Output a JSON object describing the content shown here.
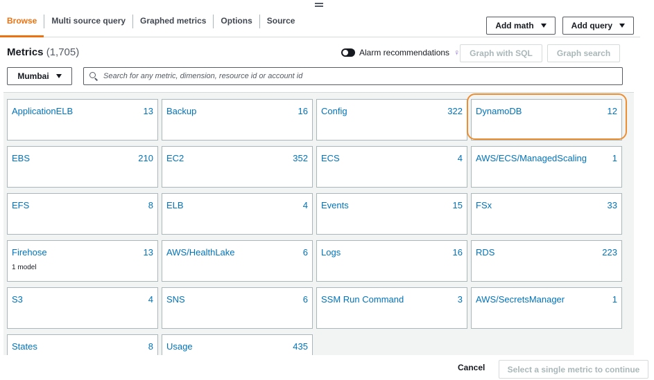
{
  "tabs": [
    {
      "label": "Browse",
      "active": true
    },
    {
      "label": "Multi source query",
      "active": false
    },
    {
      "label": "Graphed metrics",
      "active": false
    },
    {
      "label": "Options",
      "active": false
    },
    {
      "label": "Source",
      "active": false
    }
  ],
  "toolbar": {
    "add_math": "Add math",
    "add_query": "Add query"
  },
  "metrics": {
    "title": "Metrics",
    "count": "(1,705)"
  },
  "alarm": {
    "label": "Alarm recommendations",
    "enabled": false
  },
  "actions": {
    "graph_sql": "Graph with SQL",
    "graph_search": "Graph search"
  },
  "region": {
    "selected": "Mumbai"
  },
  "search": {
    "placeholder": "Search for any metric, dimension, resource id or account id",
    "value": ""
  },
  "namespaces": [
    {
      "name": "ApplicationELB",
      "count": "13",
      "sub": ""
    },
    {
      "name": "Backup",
      "count": "16",
      "sub": ""
    },
    {
      "name": "Config",
      "count": "322",
      "sub": ""
    },
    {
      "name": "DynamoDB",
      "count": "12",
      "sub": ""
    },
    {
      "name": "EBS",
      "count": "210",
      "sub": ""
    },
    {
      "name": "EC2",
      "count": "352",
      "sub": ""
    },
    {
      "name": "ECS",
      "count": "4",
      "sub": ""
    },
    {
      "name": "AWS/ECS/ManagedScaling",
      "count": "1",
      "sub": ""
    },
    {
      "name": "EFS",
      "count": "8",
      "sub": ""
    },
    {
      "name": "ELB",
      "count": "4",
      "sub": ""
    },
    {
      "name": "Events",
      "count": "15",
      "sub": ""
    },
    {
      "name": "FSx",
      "count": "33",
      "sub": ""
    },
    {
      "name": "Firehose",
      "count": "13",
      "sub": "1 model"
    },
    {
      "name": "AWS/HealthLake",
      "count": "6",
      "sub": ""
    },
    {
      "name": "Logs",
      "count": "16",
      "sub": ""
    },
    {
      "name": "RDS",
      "count": "223",
      "sub": ""
    },
    {
      "name": "S3",
      "count": "4",
      "sub": ""
    },
    {
      "name": "SNS",
      "count": "6",
      "sub": ""
    },
    {
      "name": "SSM Run Command",
      "count": "3",
      "sub": ""
    },
    {
      "name": "AWS/SecretsManager",
      "count": "1",
      "sub": ""
    },
    {
      "name": "States",
      "count": "8",
      "sub": ""
    },
    {
      "name": "Usage",
      "count": "435",
      "sub": ""
    }
  ],
  "highlighted": "DynamoDB",
  "footer": {
    "cancel": "Cancel",
    "continue": "Select a single metric to continue"
  },
  "colors": {
    "accent": "#ec7211",
    "link": "#0073bb",
    "highlight": "#ec8f33"
  }
}
